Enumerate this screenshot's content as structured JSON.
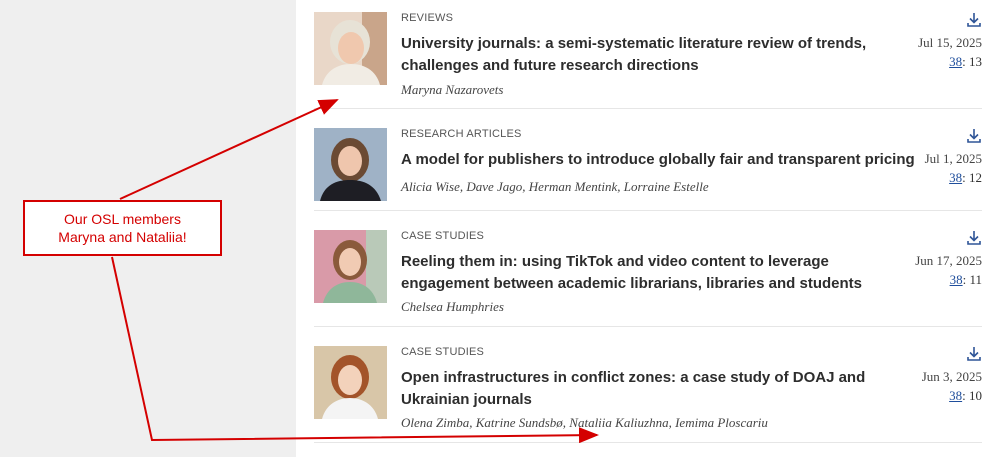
{
  "articles": [
    {
      "section": "REVIEWS",
      "title": "University journals: a semi-systematic literature review of trends, challenges and future research directions",
      "authors": "Maryna Nazarovets",
      "date": "Jul 15, 2025",
      "volume": "38",
      "issue_suffix": ": 13",
      "thumb_name": "author-photo-nazarovets"
    },
    {
      "section": "RESEARCH ARTICLES",
      "title": "A model for publishers to introduce globally fair and transparent pricing",
      "authors": "Alicia Wise, Dave Jago, Herman Mentink, Lorraine Estelle",
      "date": "Jul 1, 2025",
      "volume": "38",
      "issue_suffix": ": 12",
      "thumb_name": "author-photo-wise"
    },
    {
      "section": "CASE STUDIES",
      "title": "Reeling them in: using TikTok and video content to leverage engagement between academic librarians, libraries and students",
      "authors": "Chelsea Humphries",
      "date": "Jun 17, 2025",
      "volume": "38",
      "issue_suffix": ": 11",
      "thumb_name": "author-photo-humphries"
    },
    {
      "section": "CASE STUDIES",
      "title": "Open infrastructures in conflict zones: a case study of DOAJ and Ukrainian journals",
      "authors": "Olena Zimba, Katrine Sundsbø, Nataliia Kaliuzhna, Iemima Ploscariu",
      "date": "Jun 3, 2025",
      "volume": "38",
      "issue_suffix": ": 10",
      "thumb_name": "author-photo-zimba"
    }
  ],
  "callout": {
    "line1": "Our OSL members",
    "line2": "Maryna and Nataliia!"
  },
  "icons": {
    "download": "download-icon"
  },
  "colors": {
    "annotation": "#d40000",
    "link": "#1f4e9c",
    "sidebar_bg": "#efefef"
  }
}
